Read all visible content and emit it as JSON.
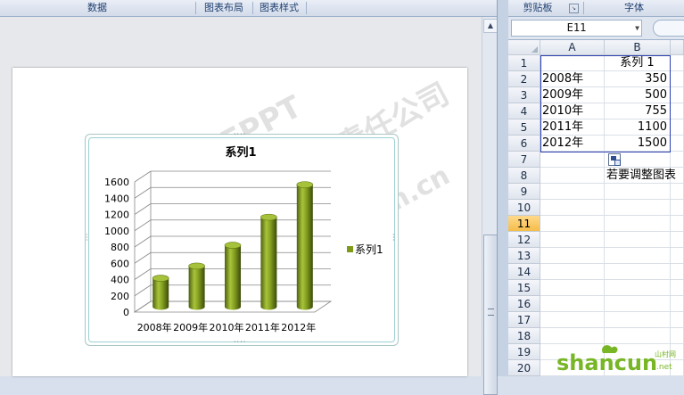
{
  "ribbon_left": {
    "groups": [
      "数据",
      "图表布局",
      "图表样式"
    ]
  },
  "ribbon_right": {
    "groups": [
      "剪贴板",
      "字体"
    ]
  },
  "formula_bar": {
    "name_box": "E11"
  },
  "spreadsheet": {
    "columns": [
      "A",
      "B"
    ],
    "rows": [
      "1",
      "2",
      "3",
      "4",
      "5",
      "6",
      "7",
      "8",
      "9",
      "10",
      "11",
      "12",
      "13",
      "14",
      "15",
      "16",
      "17",
      "18",
      "19",
      "20"
    ],
    "selected_row": "11",
    "header_cell": "系列 1",
    "data": [
      {
        "year": "2008年",
        "value": "350"
      },
      {
        "year": "2009年",
        "value": "500"
      },
      {
        "year": "2010年",
        "value": "755"
      },
      {
        "year": "2011年",
        "value": "1100"
      },
      {
        "year": "2012年",
        "value": "1500"
      }
    ],
    "note": "若要调整图表"
  },
  "watermarks": [
    "EPPT",
    "有限责任公司",
    "www.eppt.com.cn"
  ],
  "logo": {
    "text": "shancun",
    "sub": "山村网",
    "domain": ".net"
  },
  "chart_data": {
    "type": "bar",
    "title": "系列1",
    "categories": [
      "2008年",
      "2009年",
      "2010年",
      "2011年",
      "2012年"
    ],
    "series": [
      {
        "name": "系列1",
        "values": [
          350,
          500,
          755,
          1100,
          1500
        ],
        "color": "#7f9a1a"
      }
    ],
    "ylim": [
      0,
      1600
    ],
    "yticks": [
      "0",
      "200",
      "400",
      "600",
      "800",
      "1000",
      "1200",
      "1400",
      "1600"
    ],
    "legend_position": "right",
    "grid": true
  }
}
